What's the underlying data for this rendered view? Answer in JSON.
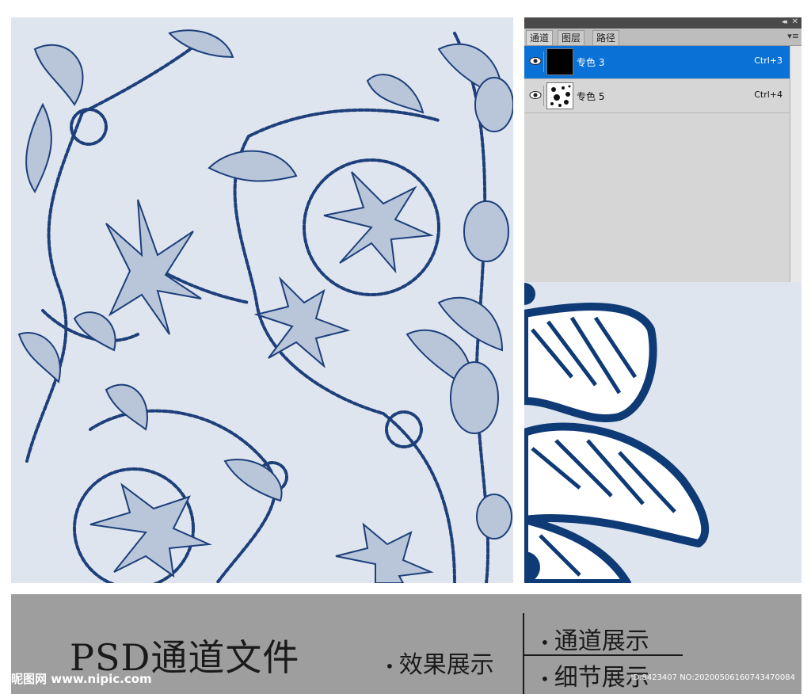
{
  "panel": {
    "tabs": [
      {
        "label": "通道",
        "active": true
      },
      {
        "label": "图层",
        "active": false
      },
      {
        "label": "路径",
        "active": false
      }
    ],
    "collapse_glyph": "◂◂",
    "close_glyph": "✕",
    "menu_glyph": "▾≡",
    "channels": [
      {
        "name": "专色 3",
        "shortcut": "Ctrl+3",
        "selected": true
      },
      {
        "name": "专色 5",
        "shortcut": "Ctrl+4",
        "selected": false
      }
    ]
  },
  "banner": {
    "title": "PSD通道文件",
    "bullet_effect": "效果展示",
    "bullet_channel": "通道展示",
    "bullet_detail": "细节展示",
    "watermark_site": "昵图网 www.nipic.com",
    "watermark_id": "ID:8423407 NO:20200506160743470084"
  },
  "colors": {
    "pattern_background": "#dfe5ef",
    "pattern_ink": "#1d3f7a",
    "selection_blue": "#0a71d6",
    "banner_gray": "#9e9e9e"
  },
  "icons": {
    "eye": "eye-icon",
    "collapse": "double-chevron-left-icon",
    "close": "close-icon",
    "menu": "panel-menu-icon"
  }
}
